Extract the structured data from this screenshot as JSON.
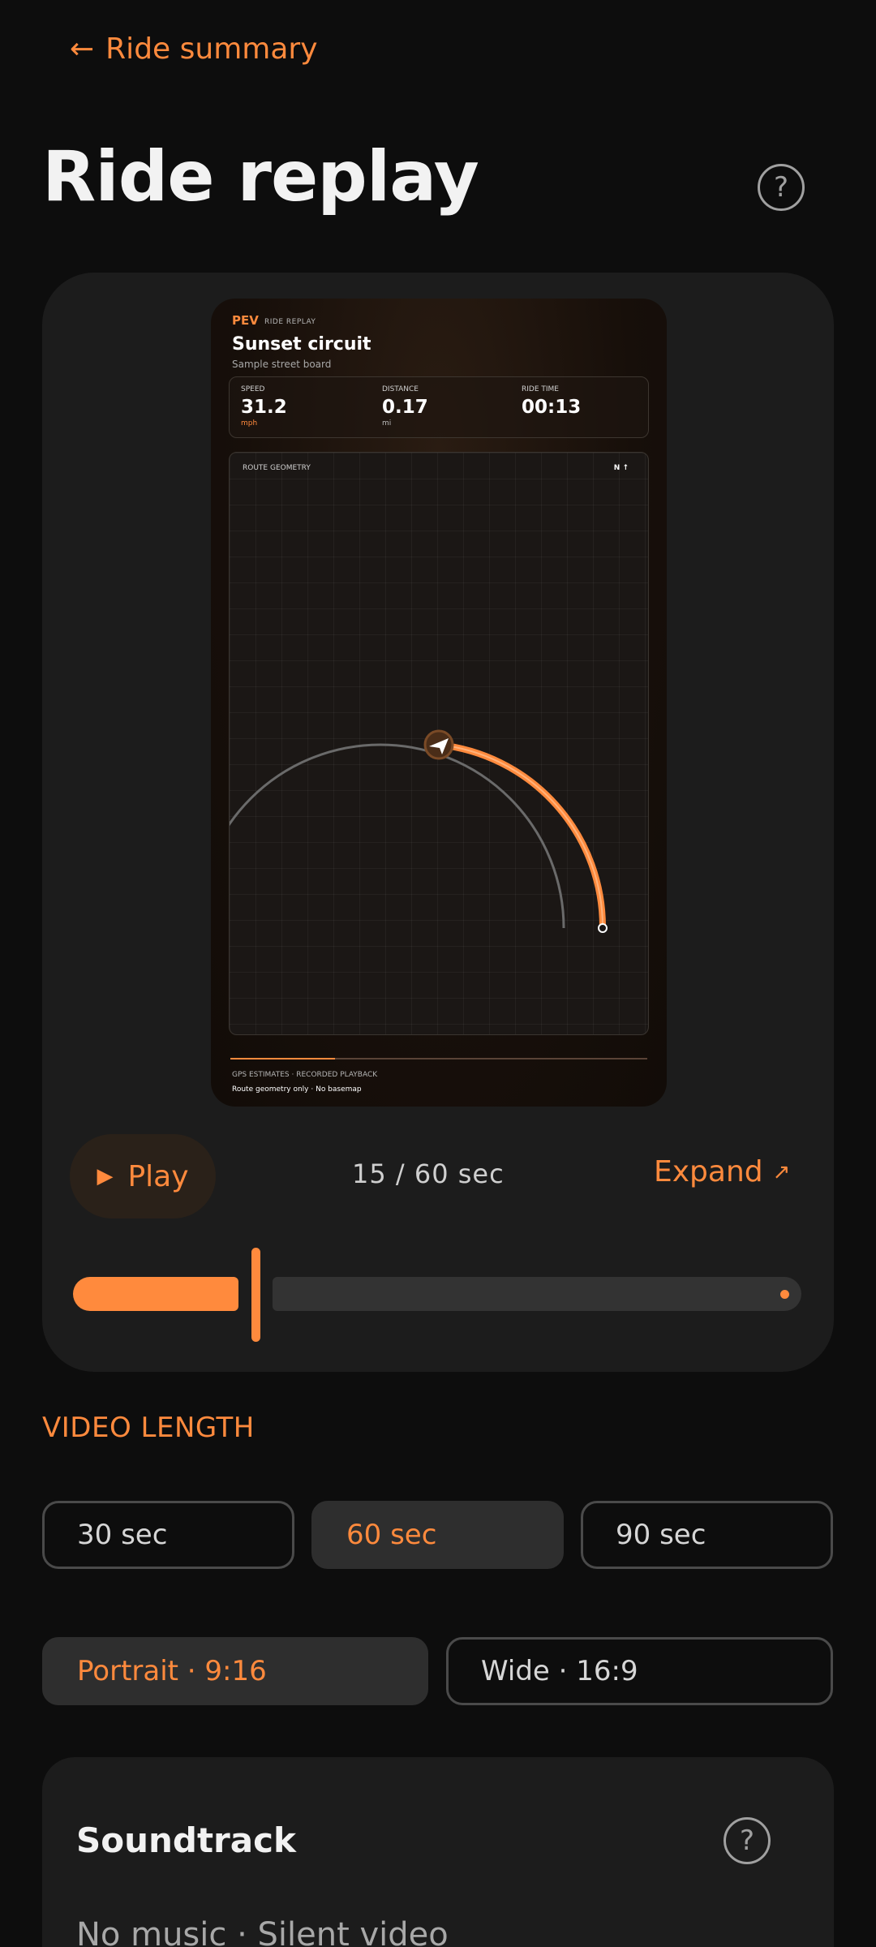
{
  "header": {
    "back_label": "Ride summary",
    "title": "Ride replay",
    "help_label": "?"
  },
  "preview": {
    "brand": "PEV",
    "tag": "RIDE REPLAY",
    "title": "Sunset circuit",
    "subtitle": "Sample street board",
    "stats": [
      {
        "label": "SPEED",
        "value": "31.2",
        "unit": "mph"
      },
      {
        "label": "DISTANCE",
        "value": "0.17",
        "unit": "mi"
      },
      {
        "label": "RIDE TIME",
        "value": "00:13",
        "unit": ""
      }
    ],
    "map_label": "ROUTE GEOMETRY",
    "north_label": "N ↑",
    "footer_line1": "GPS ESTIMATES · RECORDED PLAYBACK",
    "footer_line2": "Route geometry only · No basemap",
    "progress_fraction": 0.25
  },
  "controls": {
    "play_label": "Play",
    "time_readout": "15 / 60 sec",
    "expand_label": "Expand",
    "current_sec": 15,
    "total_sec": 60
  },
  "video_length": {
    "section_label": "VIDEO LENGTH",
    "options": [
      "30 sec",
      "60 sec",
      "90 sec"
    ],
    "selected": "60 sec"
  },
  "aspect": {
    "options": [
      "Portrait · 9:16",
      "Wide · 16:9"
    ],
    "selected": "Portrait · 9:16"
  },
  "soundtrack": {
    "title": "Soundtrack",
    "help_label": "?",
    "value": "No music · Silent video"
  },
  "colors": {
    "accent": "#ff8a3d",
    "background": "#0d0d0d",
    "card": "#1c1c1c"
  }
}
